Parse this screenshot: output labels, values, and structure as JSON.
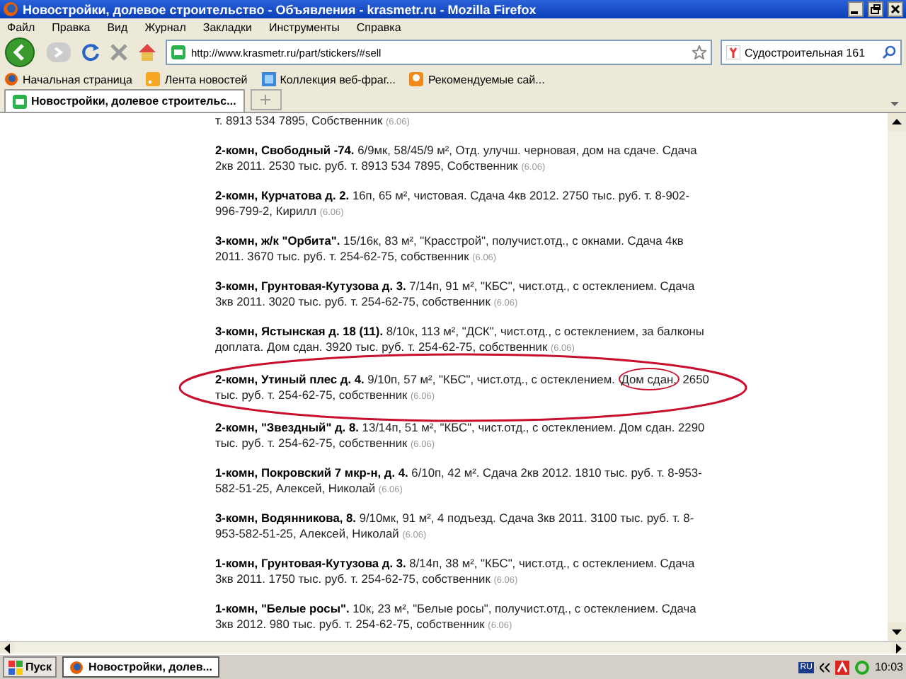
{
  "window": {
    "title": "Новостройки, долевое строительство - Объявления - krasmetr.ru - Mozilla Firefox"
  },
  "menu": [
    "Файл",
    "Правка",
    "Вид",
    "Журнал",
    "Закладки",
    "Инструменты",
    "Справка"
  ],
  "address_bar": {
    "value": "http://www.krasmetr.ru/part/stickers/#sell"
  },
  "search_field": {
    "value": "Судостроительная 161"
  },
  "bookmarks": [
    {
      "label": "Начальная страница",
      "kind": "firefox"
    },
    {
      "label": "Лента новостей",
      "kind": "rss"
    },
    {
      "label": "Коллекция веб-фраг...",
      "kind": "web"
    },
    {
      "label": "Рекомендуемые сай...",
      "kind": "bulb"
    }
  ],
  "tabs": [
    {
      "label": "Новостройки, долевое строительс...",
      "selected": true
    }
  ],
  "listings": [
    {
      "text": "т. 8913 534 7895, Собственник",
      "date": "(6.06)",
      "circled": false
    },
    {
      "text": "**2-комн, Свободный -74.** 6/9мк, 58/45/9 м², Отд. улучш. черновая, дом на сдаче. Сдача 2кв 2011. 2530 тыс. руб. т. 8913 534 7895, Собственник",
      "date": "(6.06)",
      "circled": false
    },
    {
      "text": "**2-комн, Курчатова д. 2.** 16п, 65 м², чистовая. Сдача 4кв 2012. 2750 тыс. руб. т. 8-902-996-799-2, Кирилл",
      "date": "(6.06)",
      "circled": false
    },
    {
      "text": "**3-комн, ж/к \"Орбита\".** 15/16к, 83 м², \"Красстрой\", получист.отд., с окнами. Сдача 4кв 2011. 3670 тыс. руб. т. 254-62-75, собственник",
      "date": "(6.06)",
      "circled": false
    },
    {
      "text": "**3-комн, Грунтовая-Кутузова д. 3.** 7/14п, 91 м², \"КБС\", чист.отд., с остеклением. Сдача 3кв 2011. 3020 тыс. руб. т. 254-62-75, собственник",
      "date": "(6.06)",
      "circled": false
    },
    {
      "text": "**3-комн, Ястынская д. 18 (11).** 8/10к, 113 м², \"ДСК\", чист.отд., с остеклением, за балконы доплата. Дом сдан. 3920 тыс. руб. т. 254-62-75, собственник",
      "date": "(6.06)",
      "circled": false
    },
    {
      "text": "**2-комн, Утиный плес д. 4.** 9/10п, 57 м², \"КБС\", чист.отд., с остеклением.",
      "circled_text": "Дом сдан.",
      "text_after": "2650 тыс. руб. т. 254-62-75, собственник",
      "date": "(6.06)",
      "circled": true
    },
    {
      "text": "**2-комн, \"Звездный\" д. 8.** 13/14п, 51 м², \"КБС\", чист.отд., с остеклением. Дом сдан. 2290 тыс. руб. т. 254-62-75, собственник",
      "date": "(6.06)",
      "circled": false
    },
    {
      "text": "**1-комн, Покровский 7 мкр-н, д. 4.** 6/10п, 42 м². Сдача 2кв 2012. 1810 тыс. руб. т. 8-953-582-51-25, Алексей, Николай",
      "date": "(6.06)",
      "circled": false
    },
    {
      "text": "**3-комн, Водянникова, 8.** 9/10мк, 91 м², 4 подъезд. Сдача 3кв 2011. 3100 тыс. руб. т. 8-953-582-51-25, Алексей, Николай",
      "date": "(6.06)",
      "circled": false
    },
    {
      "text": "**1-комн, Грунтовая-Кутузова д. 3.** 8/14п, 38 м², \"КБС\", чист.отд., с остеклением. Сдача 3кв 2011. 1750 тыс. руб. т. 254-62-75, собственник",
      "date": "(6.06)",
      "circled": false
    },
    {
      "text": "**1-комн, \"Белые росы\".** 10к, 23 м², \"Белые росы\", получист.отд., с остеклением. Сдача 3кв 2012. 980 тыс. руб. т. 254-62-75, собственник",
      "date": "(6.06)",
      "circled": false
    }
  ],
  "taskbar": {
    "start": "Пуск",
    "tasks": [
      {
        "label": "Новостройки, долев...",
        "selected": true
      }
    ],
    "tray_language": "RU",
    "clock": "10:03"
  }
}
